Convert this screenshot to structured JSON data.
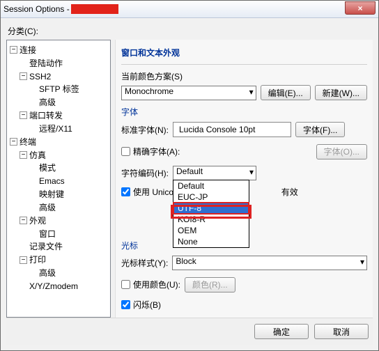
{
  "titlebar": {
    "prefix": "Session Options -",
    "close": "×"
  },
  "category_label": "分类(C):",
  "tree": {
    "n0": "连接",
    "n0_0": "登陆动作",
    "n0_1": "SSH2",
    "n0_1_0": "SFTP 标签",
    "n0_1_1": "高级",
    "n0_2": "端口转发",
    "n0_2_0": "远程/X11",
    "n1": "终端",
    "n1_0": "仿真",
    "n1_0_0": "模式",
    "n1_0_1": "Emacs",
    "n1_0_2": "映射键",
    "n1_0_3": "高级",
    "n1_1": "外观",
    "n1_1_0": "窗口",
    "n1_2": "记录文件",
    "n1_3": "打印",
    "n1_3_0": "高级",
    "n1_4": "X/Y/Zmodem"
  },
  "panel": {
    "title": "窗口和文本外观",
    "scheme_label": "当前颜色方案(S)",
    "scheme_value": "Monochrome",
    "edit_btn": "编辑(E)...",
    "new_btn": "新建(W)...",
    "font_head": "字体",
    "std_font_label": "标准字体(N):",
    "std_font_value": "Lucida Console 10pt",
    "font_btn": "字体(F)...",
    "exact_font": "精确字体(A):",
    "font_btn2": "字体(O)...",
    "encoding_label": "字符编码(H):",
    "encoding_value": "Default",
    "dd": {
      "o0": "Default",
      "o1": "EUC-JP",
      "o2": "UTF-8",
      "o3": "KOI8-R",
      "o4": "OEM",
      "o5": "None"
    },
    "unicode_chk": "使用 Unicode 线条",
    "valid_suffix": "有效",
    "cursor_head": "光标",
    "cursor_style_label": "光标样式(Y):",
    "cursor_style_value": "Block",
    "use_color": "使用颜色(U):",
    "color_btn": "颜色(R)...",
    "blink": "闪烁(B)"
  },
  "footer": {
    "ok": "确定",
    "cancel": "取消"
  }
}
